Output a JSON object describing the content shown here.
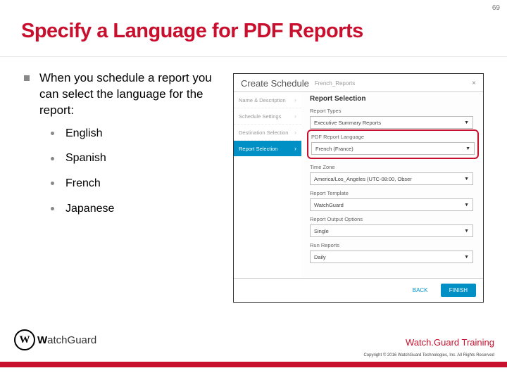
{
  "page_number": "69",
  "title": "Specify a Language for PDF Reports",
  "bullet": "When you schedule a report you can select the language for the report:",
  "langs": [
    "English",
    "Spanish",
    "French",
    "Japanese"
  ],
  "shot": {
    "heading": "Create Schedule",
    "heading_sub": "French_Reports",
    "close": "×",
    "steps": {
      "name": "Name & Description",
      "sched": "Schedule Settings",
      "dest": "Destination Selection",
      "active": "Report Selection"
    },
    "panel_title": "Report Selection",
    "report_types_lbl": "Report Types",
    "report_types_val": "Executive Summary Reports",
    "pdf_lang_lbl": "PDF Report Language",
    "pdf_lang_val": "French (France)",
    "tz_lbl": "Time Zone",
    "tz_val": "America/Los_Angeles (UTC-08:00, Obser",
    "tmpl_lbl": "Report Template",
    "tmpl_val": "WatchGuard",
    "out_lbl": "Report Output Options",
    "out_val": "Single",
    "run_lbl": "Run Reports",
    "run_val": "Daily",
    "back": "BACK",
    "finish": "FINISH"
  },
  "brand": {
    "w": "W",
    "rest": "atchGuard"
  },
  "training": "Watch.Guard Training",
  "copyright": "Copyright © 2016 WatchGuard Technologies, Inc. All Rights Reserved"
}
